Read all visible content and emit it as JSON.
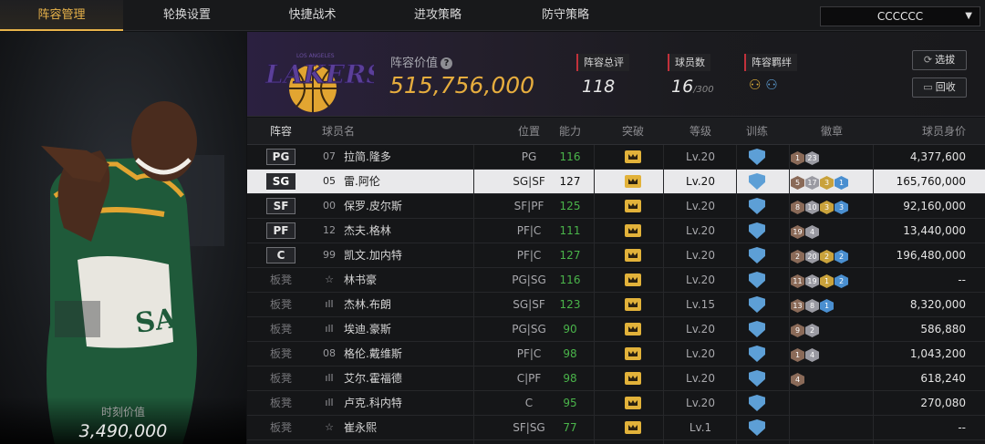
{
  "tabs": [
    "阵容管理",
    "轮换设置",
    "快捷战术",
    "进攻策略",
    "防守策略"
  ],
  "active_tab": 0,
  "dropdown": {
    "value": "CCCCCC"
  },
  "player_panel": {
    "value_label": "时刻价值",
    "value": "3,490,000"
  },
  "team": {
    "logo_text": "LAKERS",
    "logo_top": "LOS ANGELES",
    "value_label": "阵容价值",
    "value": "515,756,000",
    "rating_label": "阵容总评",
    "rating": "118",
    "players_label": "球员数",
    "players": "16",
    "players_max": "/300",
    "bond_label": "阵容羁绊"
  },
  "buttons": {
    "select": "选拔",
    "recycle": "回收"
  },
  "columns": [
    "阵容",
    "球员名",
    "位置",
    "能力",
    "突破",
    "等级",
    "训练",
    "徽章",
    "球员身价"
  ],
  "rows": [
    {
      "slot": "PG",
      "num": "07",
      "name": "拉简.隆多",
      "role": "PG",
      "ability": "116",
      "level": "Lv.20",
      "badges": [
        [
          "b-br",
          "1"
        ],
        [
          "b-si",
          "23"
        ]
      ],
      "value": "4,377,600"
    },
    {
      "slot": "SG",
      "num": "05",
      "name": "雷.阿伦",
      "role": "SG|SF",
      "ability": "127",
      "level": "Lv.20",
      "badges": [
        [
          "b-br",
          "5"
        ],
        [
          "b-si",
          "17"
        ],
        [
          "b-go",
          "3"
        ],
        [
          "b-bl",
          "1"
        ]
      ],
      "value": "165,760,000",
      "selected": true
    },
    {
      "slot": "SF",
      "num": "00",
      "name": "保罗.皮尔斯",
      "role": "SF|PF",
      "ability": "125",
      "level": "Lv.20",
      "badges": [
        [
          "b-br",
          "8"
        ],
        [
          "b-si",
          "10"
        ],
        [
          "b-go",
          "3"
        ],
        [
          "b-bl",
          "3"
        ]
      ],
      "value": "92,160,000"
    },
    {
      "slot": "PF",
      "num": "12",
      "name": "杰夫.格林",
      "role": "PF|C",
      "ability": "111",
      "level": "Lv.20",
      "badges": [
        [
          "b-br",
          "19"
        ],
        [
          "b-si",
          "4"
        ]
      ],
      "value": "13,440,000"
    },
    {
      "slot": "C",
      "num": "99",
      "name": "凯文.加内特",
      "role": "PF|C",
      "ability": "127",
      "level": "Lv.20",
      "badges": [
        [
          "b-br",
          "2"
        ],
        [
          "b-si",
          "20"
        ],
        [
          "b-go",
          "2"
        ],
        [
          "b-bl",
          "2"
        ]
      ],
      "value": "196,480,000"
    },
    {
      "slot": "板凳",
      "num": "☆",
      "name": "林书豪",
      "role": "PG|SG",
      "ability": "116",
      "level": "Lv.20",
      "badges": [
        [
          "b-br",
          "11"
        ],
        [
          "b-si",
          "19"
        ],
        [
          "b-go",
          "1"
        ],
        [
          "b-bl",
          "2"
        ]
      ],
      "value": "--"
    },
    {
      "slot": "板凳",
      "num": "ıll",
      "name": "杰林.布朗",
      "role": "SG|SF",
      "ability": "123",
      "level": "Lv.15",
      "badges": [
        [
          "b-br",
          "13"
        ],
        [
          "b-si",
          "8"
        ],
        [
          "b-bl",
          "1"
        ]
      ],
      "value": "8,320,000"
    },
    {
      "slot": "板凳",
      "num": "ıll",
      "name": "埃迪.豪斯",
      "role": "PG|SG",
      "ability": "90",
      "level": "Lv.20",
      "badges": [
        [
          "b-br",
          "9"
        ],
        [
          "b-si",
          "2"
        ]
      ],
      "value": "586,880"
    },
    {
      "slot": "板凳",
      "num": "08",
      "name": "格伦.戴维斯",
      "role": "PF|C",
      "ability": "98",
      "level": "Lv.20",
      "badges": [
        [
          "b-br",
          "1"
        ],
        [
          "b-si",
          "4"
        ]
      ],
      "value": "1,043,200"
    },
    {
      "slot": "板凳",
      "num": "ıll",
      "name": "艾尔.霍福德",
      "role": "C|PF",
      "ability": "98",
      "level": "Lv.20",
      "badges": [
        [
          "b-br",
          "4"
        ]
      ],
      "value": "618,240"
    },
    {
      "slot": "板凳",
      "num": "ıll",
      "name": "卢克.科内特",
      "role": "C",
      "ability": "95",
      "level": "Lv.20",
      "badges": [],
      "value": "270,080"
    },
    {
      "slot": "板凳",
      "num": "☆",
      "name": "崔永熙",
      "role": "SF|SG",
      "ability": "77",
      "level": "Lv.1",
      "badges": [],
      "value": "--"
    }
  ]
}
